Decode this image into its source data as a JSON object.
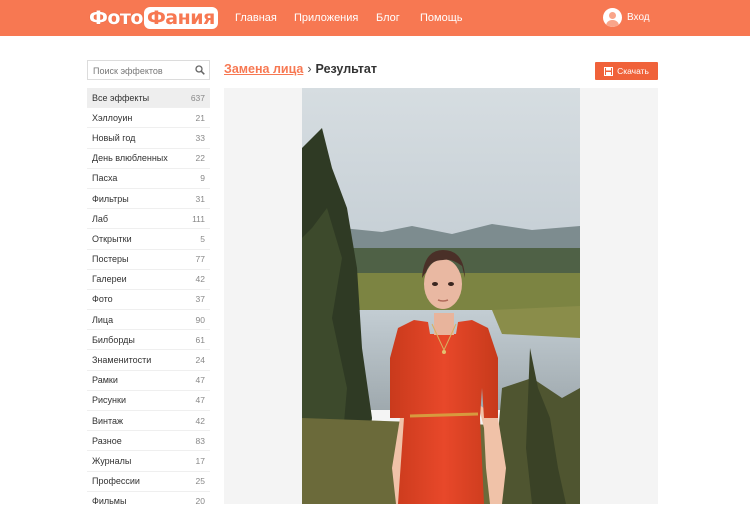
{
  "header": {
    "logo": {
      "part1": "Фото",
      "part2": "Фания"
    },
    "nav": [
      {
        "label": "Главная"
      },
      {
        "label": "Приложения"
      },
      {
        "label": "Блог"
      },
      {
        "label": "Помощь"
      }
    ],
    "login_label": "Вход"
  },
  "search": {
    "placeholder": "Поиск эффектов",
    "icon": "search-icon"
  },
  "sidebar": {
    "items": [
      {
        "label": "Все эффекты",
        "count": "637",
        "active": true
      },
      {
        "label": "Хэллоуин",
        "count": "21"
      },
      {
        "label": "Новый год",
        "count": "33"
      },
      {
        "label": "День влюбленных",
        "count": "22"
      },
      {
        "label": "Пасха",
        "count": "9"
      },
      {
        "label": "Фильтры",
        "count": "31"
      },
      {
        "label": "Лаб",
        "count": "111"
      },
      {
        "label": "Открытки",
        "count": "5"
      },
      {
        "label": "Постеры",
        "count": "77"
      },
      {
        "label": "Галереи",
        "count": "42"
      },
      {
        "label": "Фото",
        "count": "37"
      },
      {
        "label": "Лица",
        "count": "90"
      },
      {
        "label": "Билборды",
        "count": "61"
      },
      {
        "label": "Знаменитости",
        "count": "24"
      },
      {
        "label": "Рамки",
        "count": "47"
      },
      {
        "label": "Рисунки",
        "count": "47"
      },
      {
        "label": "Винтаж",
        "count": "42"
      },
      {
        "label": "Разное",
        "count": "83"
      },
      {
        "label": "Журналы",
        "count": "17"
      },
      {
        "label": "Профессии",
        "count": "25"
      },
      {
        "label": "Фильмы",
        "count": "20"
      }
    ]
  },
  "breadcrumb": {
    "link": "Замена лица",
    "separator": "›",
    "current": "Результат"
  },
  "download": {
    "label": "Скачать",
    "icon": "save-icon"
  },
  "colors": {
    "brand": "#f77852",
    "button": "#f0623a",
    "dress": "#e2401f"
  }
}
